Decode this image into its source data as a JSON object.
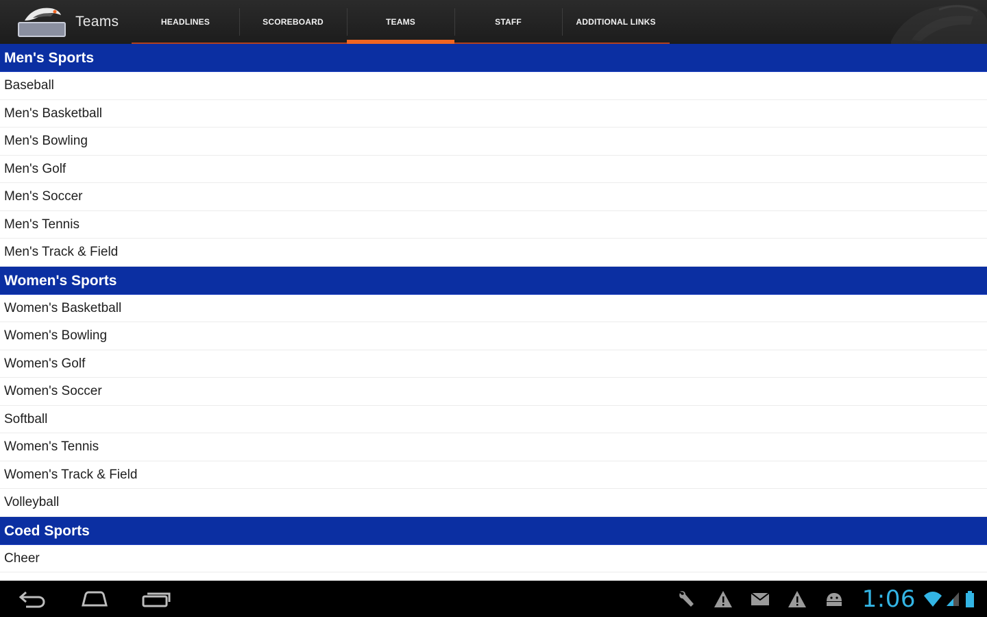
{
  "actionbar": {
    "title": "Teams",
    "tabs": [
      {
        "label": "HEADLINES",
        "selected": false
      },
      {
        "label": "SCOREBOARD",
        "selected": false
      },
      {
        "label": "TEAMS",
        "selected": true
      },
      {
        "label": "STAFF",
        "selected": false
      },
      {
        "label": "ADDITIONAL LINKS",
        "selected": false
      }
    ],
    "accent_color": "#f26522"
  },
  "sections": [
    {
      "title": "Men's Sports",
      "items": [
        "Baseball",
        "Men's Basketball",
        "Men's Bowling",
        "Men's Golf",
        "Men's Soccer",
        "Men's Tennis",
        "Men's Track & Field"
      ]
    },
    {
      "title": "Women's Sports",
      "items": [
        "Women's Basketball",
        "Women's Bowling",
        "Women's Golf",
        "Women's Soccer",
        "Softball",
        "Women's Tennis",
        "Women's Track & Field",
        "Volleyball"
      ]
    },
    {
      "title": "Coed Sports",
      "items": [
        "Cheer"
      ]
    }
  ],
  "header_color": "#0b2fa2",
  "system_bar": {
    "nav_icons": [
      "back-icon",
      "home-icon",
      "recent-apps-icon"
    ],
    "status_icons": [
      "wrench-icon",
      "warning-icon",
      "mail-icon",
      "warning-icon",
      "android-icon"
    ],
    "clock": "1:06",
    "clock_color": "#33b5e5"
  }
}
